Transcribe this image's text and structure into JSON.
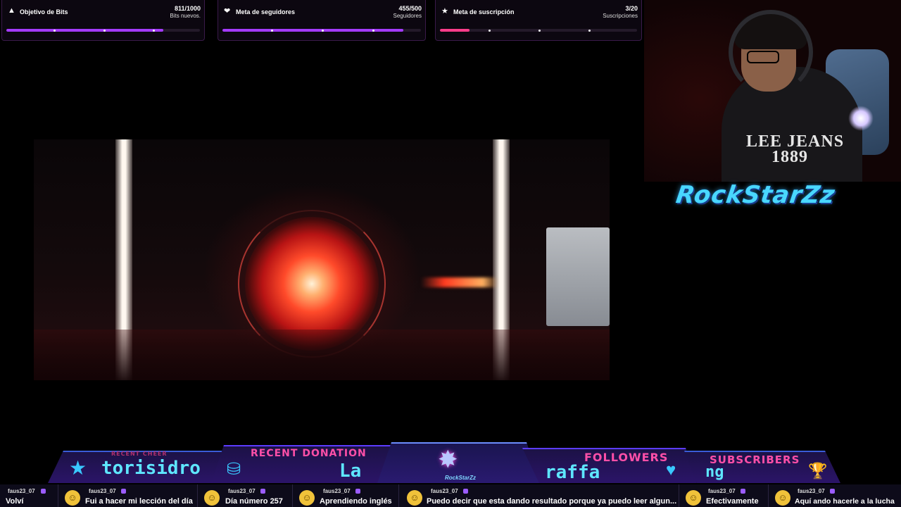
{
  "goals": [
    {
      "icon": "bits-icon",
      "glyph": "▲",
      "title": "Objetivo de Bits",
      "count": "811/1000",
      "subtitle": "Bits nuevos.",
      "progress": 0.811,
      "color": "#a43bff"
    },
    {
      "icon": "heart-icon",
      "glyph": "❤",
      "title": "Meta de seguidores",
      "count": "455/500",
      "subtitle": "Seguidores",
      "progress": 0.91,
      "color": "#a43bff"
    },
    {
      "icon": "star-icon",
      "glyph": "★",
      "title": "Meta de suscripción",
      "count": "3/20",
      "subtitle": "Suscripciones",
      "progress": 0.15,
      "color": "#ff3d8a"
    }
  ],
  "webcam": {
    "shirt_text_line1": "LEE JEANS",
    "shirt_text_line2": "1889"
  },
  "logo_text": "RockStarZz",
  "bottom_bar": {
    "recent_cheer": {
      "label": "RECENT CHEER",
      "value": "torisidro",
      "icon": "star-icon"
    },
    "recent_donation": {
      "label": "RECENT DONATION",
      "value": "La",
      "icon": "coin-icon"
    },
    "center": {
      "name": "RockStarZz"
    },
    "followers": {
      "label": "FOLLOWERS",
      "value": "raffa",
      "icon": "heart-icon"
    },
    "subscribers": {
      "label": "SUBSCRIBERS",
      "value": "ng",
      "icon": "trophy-icon"
    }
  },
  "chat": [
    {
      "user": "faus23_07",
      "text": "Volví",
      "avatar": false
    },
    {
      "user": "faus23_07",
      "text": "Fui a hacer mi lección del día",
      "avatar": true
    },
    {
      "user": "faus23_07",
      "text": "Día número 257",
      "avatar": true
    },
    {
      "user": "faus23_07",
      "text": "Aprendiendo inglés",
      "avatar": true
    },
    {
      "user": "faus23_07",
      "text": "Puedo decir que esta dando resultado porque ya puedo leer algun...",
      "avatar": true
    },
    {
      "user": "faus23_07",
      "text": "Efectivamente",
      "avatar": true
    },
    {
      "user": "faus23_07",
      "text": "Aquí ando hacerle a la lucha",
      "avatar": true
    }
  ]
}
